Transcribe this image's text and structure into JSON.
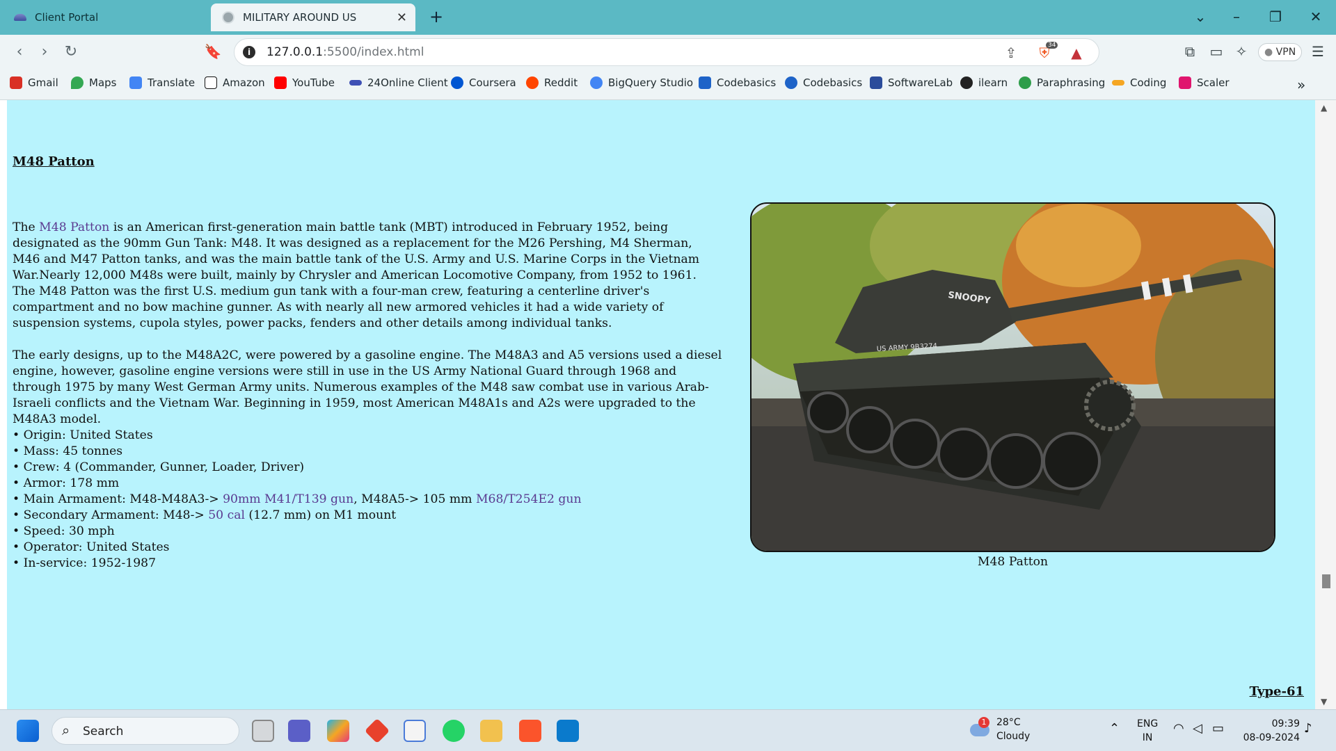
{
  "browser": {
    "tabs": [
      {
        "title": "Client Portal"
      },
      {
        "title": "MILITARY AROUND US"
      }
    ],
    "address": {
      "host": "127.0.0.1",
      "path": ":5500/index.html"
    },
    "extension_badge": "34",
    "vpn_label": "VPN",
    "bookmarks": [
      {
        "label": "Gmail",
        "color": "#d93025"
      },
      {
        "label": "Maps",
        "color": "#34a853"
      },
      {
        "label": "Translate",
        "color": "#4285f4"
      },
      {
        "label": "Amazon",
        "color": "#111111"
      },
      {
        "label": "YouTube",
        "color": "#ff0000"
      },
      {
        "label": "24Online Client",
        "color": "#3f51b5"
      },
      {
        "label": "Coursera",
        "color": "#0056d2"
      },
      {
        "label": "Reddit",
        "color": "#ff4500"
      },
      {
        "label": "BigQuery Studio",
        "color": "#4285f4"
      },
      {
        "label": "Codebasics",
        "color": "#1e63c8"
      },
      {
        "label": "Codebasics",
        "color": "#1e63c8"
      },
      {
        "label": "SoftwareLab",
        "color": "#2b4c9b"
      },
      {
        "label": "ilearn",
        "color": "#222222"
      },
      {
        "label": "Paraphrasing",
        "color": "#2e9d4a"
      },
      {
        "label": "Coding",
        "color": "#f5a623"
      },
      {
        "label": "Scaler",
        "color": "#e0156e"
      }
    ]
  },
  "page": {
    "heading": "M48 Patton",
    "para1": {
      "pre": "The ",
      "link": "M48 Patton",
      "post": " is an American first-generation main battle tank (MBT) introduced in February 1952, being designated as the 90mm Gun Tank: M48. It was designed as a replacement for the M26 Pershing, M4 Sherman, M46 and M47 Patton tanks, and was the main battle tank of the U.S. Army and U.S. Marine Corps in the Vietnam War.Nearly 12,000 M48s were built, mainly by Chrysler and American Locomotive Company, from 1952 to 1961. The M48 Patton was the first U.S. medium gun tank with a four-man crew, featuring a centerline driver's compartment and no bow machine gunner. As with nearly all new armored vehicles it had a wide variety of suspension systems, cupola styles, power packs, fenders and other details among individual tanks."
    },
    "para2": "The early designs, up to the M48A2C, were powered by a gasoline engine. The M48A3 and A5 versions used a diesel engine, however, gasoline engine versions were still in use in the US Army National Guard through 1968 and through 1975 by many West German Army units. Numerous examples of the M48 saw combat use in various Arab-Israeli conflicts and the Vietnam War. Beginning in 1959, most American M48A1s and A2s were upgraded to the M48A3 model.",
    "specs": {
      "origin": "• Origin: United States",
      "mass": "• Mass: 45 tonnes",
      "crew": "• Crew: 4 (Commander, Gunner, Loader, Driver)",
      "armor": "• Armor: 178 mm",
      "main_pre": "• Main Armament: M48-M48A3-> ",
      "main_link1": "90mm M41/T139 gun",
      "main_mid": ", M48A5-> 105 mm ",
      "main_link2": "M68/T254E2 gun",
      "sec_pre": "• Secondary Armament: M48-> ",
      "sec_link": "50 cal",
      "sec_post": " (12.7 mm) on M1 mount",
      "speed": "• Speed: 30 mph",
      "operator": "• Operator: United States",
      "service": "• In-service: 1952-1987"
    },
    "image_caption": "M48 Patton",
    "tank_marking_turret": "SNOOPY",
    "tank_marking_hull": "US ARMY 9B3274",
    "next_link": "Type-61"
  },
  "taskbar": {
    "search_label": "Search",
    "weather_temp": "28°C",
    "weather_desc": "Cloudy",
    "weather_badge": "1",
    "lang_top": "ENG",
    "lang_bottom": "IN",
    "time": "09:39",
    "date": "08-09-2024"
  }
}
